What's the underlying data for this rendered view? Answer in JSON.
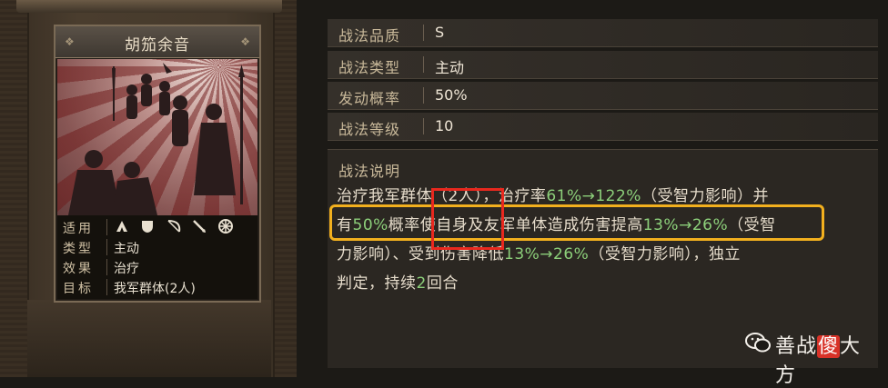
{
  "card": {
    "title": "胡笳余音",
    "rows": [
      {
        "key": "适用",
        "value": ""
      },
      {
        "key": "类型",
        "value": "主动"
      },
      {
        "key": "效果",
        "value": "治疗"
      },
      {
        "key": "目标",
        "value": "我军群体(2人)"
      }
    ],
    "unit_icons": [
      "cavalry-icon",
      "shield-icon",
      "bow-icon",
      "spear-icon",
      "chariot-wheel-icon"
    ]
  },
  "attributes": [
    {
      "key": "战法品质",
      "value": "S"
    },
    {
      "key": "战法类型",
      "value": "主动"
    },
    {
      "key": "发动概率",
      "value": "50%"
    },
    {
      "key": "战法等级",
      "value": "10"
    }
  ],
  "description": {
    "title": "战法说明",
    "line1": {
      "a": "治疗我军群体（2人），治疗率",
      "n1": "61%→122%",
      "b": "（受智力影响）并"
    },
    "line2": {
      "a": "有",
      "n1": "50%",
      "b": "概率使自身及友军单体造成伤害提高",
      "n2": "13%→26%",
      "c": "（受智"
    },
    "line3": {
      "a": "力影响）、受到伤害降低",
      "n1": "13%→26%",
      "b": "（受智力影响），独立"
    },
    "line4": {
      "a": "判定，持续",
      "n1": "2",
      "b": "回合"
    }
  },
  "watermark": {
    "text_a": "善战",
    "text_mark": "傻",
    "text_b": "大方"
  },
  "colors": {
    "highlight_number": "#8ccf7a",
    "box_yellow": "#f2b01e",
    "box_red": "#e8281e"
  }
}
